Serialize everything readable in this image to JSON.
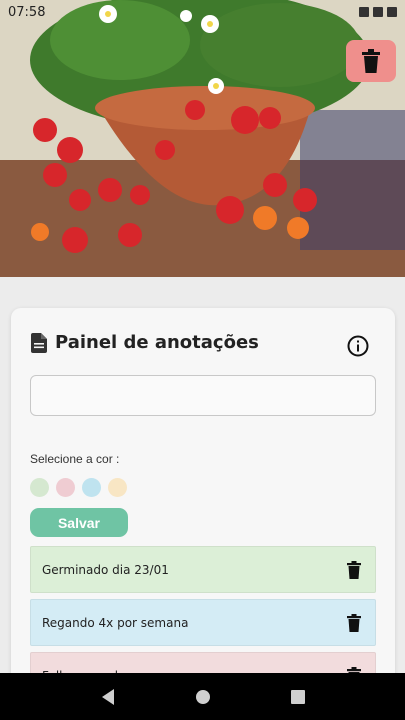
{
  "status_bar": {
    "time": "07:58"
  },
  "hero": {
    "description_icon": "strawberry-plant-image"
  },
  "card": {
    "title": "Painel de anotações",
    "input_value": "",
    "input_placeholder": "",
    "color_label": "Selecione a cor :",
    "swatches": [
      {
        "name": "green",
        "color": "#d5e8d0"
      },
      {
        "name": "pink",
        "color": "#efccd2"
      },
      {
        "name": "blue",
        "color": "#bfe3ef"
      },
      {
        "name": "yellow",
        "color": "#f8e6c4"
      }
    ],
    "save_label": "Salvar",
    "notes": [
      {
        "text": "Germinado dia 23/01",
        "color": "#dcefd7"
      },
      {
        "text": "Regando 4x por semana",
        "color": "#d4ecf5"
      },
      {
        "text": "Folhas murchas",
        "color": "#f2dcdd"
      }
    ]
  },
  "colors": {
    "delete_fab": "#ef8f8c",
    "save_button": "#6fc4a4",
    "nav_bar": "#000000"
  }
}
